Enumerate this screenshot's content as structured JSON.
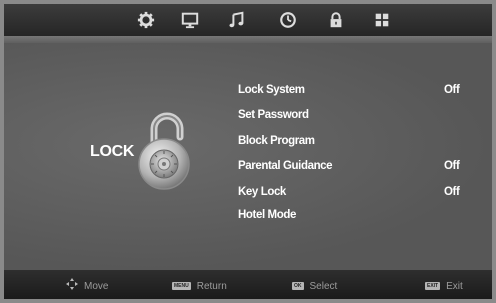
{
  "tabs": [
    {
      "id": "picture",
      "icon": "gear-icon"
    },
    {
      "id": "screen",
      "icon": "monitor-icon"
    },
    {
      "id": "sound",
      "icon": "music-note-icon"
    },
    {
      "id": "time",
      "icon": "clock-icon"
    },
    {
      "id": "lock",
      "icon": "lock-icon",
      "active": true
    },
    {
      "id": "setup",
      "icon": "grid-icon"
    }
  ],
  "page": {
    "title": "LOCK"
  },
  "menu": {
    "items": [
      {
        "label": "Lock System",
        "value": "Off"
      },
      {
        "label": "Set Password",
        "value": ""
      },
      {
        "label": "Block Program",
        "value": ""
      },
      {
        "label": "Parental Guidance",
        "value": "Off"
      },
      {
        "label": "Key Lock",
        "value": "Off"
      },
      {
        "label": "Hotel Mode",
        "value": ""
      }
    ]
  },
  "footer": {
    "move": {
      "label": "Move"
    },
    "return": {
      "key": "MENU",
      "label": "Return"
    },
    "select": {
      "key": "OK",
      "label": "Select"
    },
    "exit": {
      "key": "EXIT",
      "label": "Exit"
    }
  },
  "colors": {
    "background": "#5f5f5f",
    "topbar": "#2c2c2c",
    "bottombar": "#222222",
    "text": "#ffffff",
    "hint_text": "#9c9c9c"
  }
}
